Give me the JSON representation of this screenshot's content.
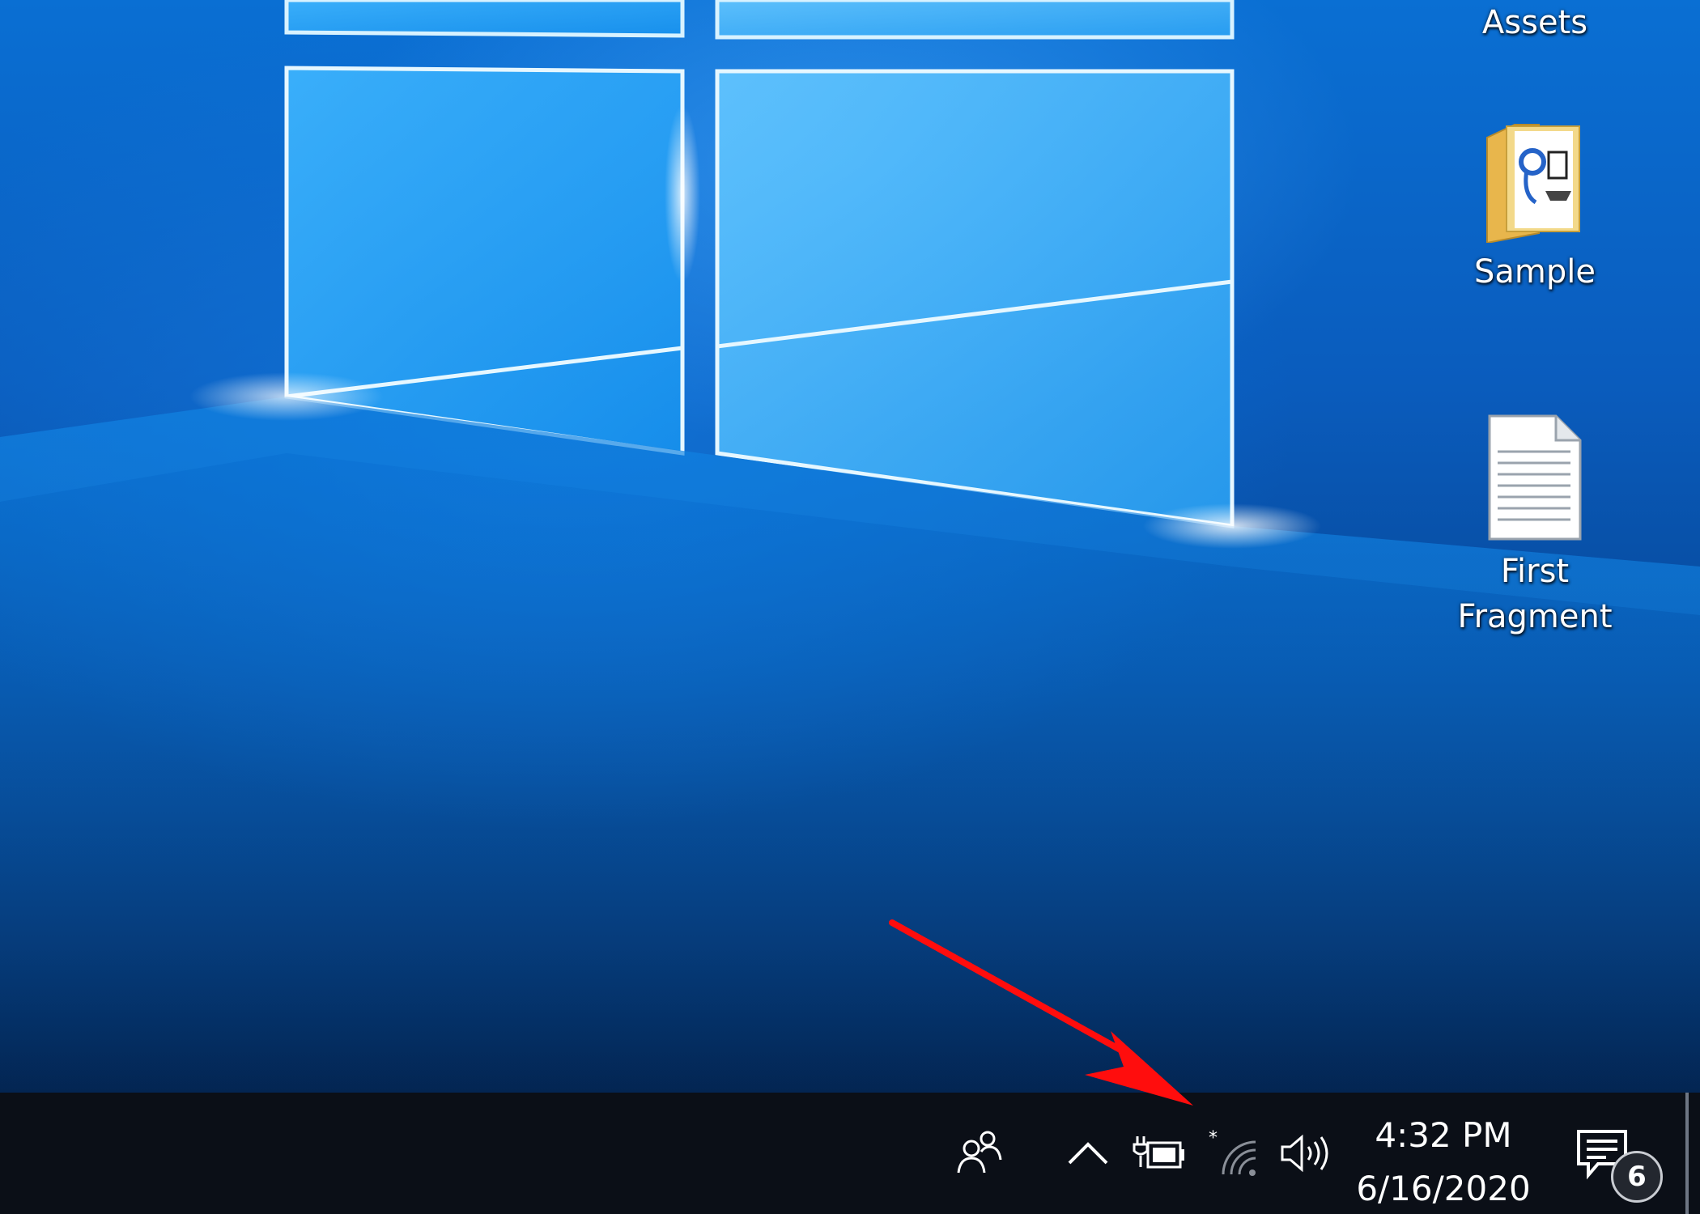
{
  "desktop": {
    "icons": [
      {
        "label": "Assets",
        "icon": "folder-icon"
      },
      {
        "label": "Sample",
        "icon": "folder-icon"
      },
      {
        "label": "First Fragment",
        "icon": "text-document-icon"
      }
    ]
  },
  "taskbar": {
    "tray": {
      "people_icon": "people-icon",
      "overflow_icon": "chevron-up-icon",
      "battery_icon": "battery-charging-icon",
      "network_icon": "wifi-icon",
      "volume_icon": "speaker-icon"
    },
    "clock": {
      "time": "4:32 PM",
      "date": "6/16/2020"
    },
    "action_center": {
      "icon": "notifications-icon",
      "badge_count": "6"
    }
  },
  "annotation": {
    "arrow_color": "#ff0d0d",
    "target": "battery-charging-icon"
  },
  "colors": {
    "taskbar_bg": "#0b0f17",
    "wallpaper_primary": "#0a6fd3",
    "text": "#ffffff"
  }
}
